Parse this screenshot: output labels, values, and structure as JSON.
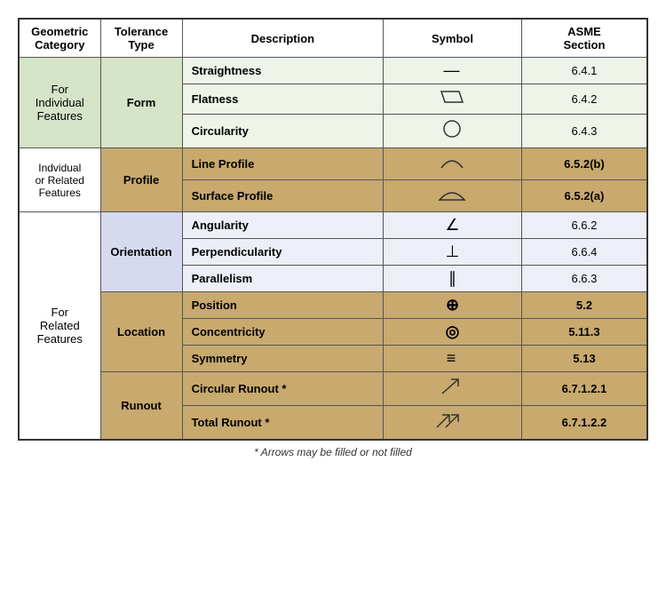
{
  "table": {
    "headers": [
      "Geometric Category",
      "Tolerance Type",
      "Description",
      "Symbol",
      "ASME Section"
    ],
    "footnote": "* Arrows may be filled or not filled",
    "rows": {
      "form": {
        "geo_cat": "For Individual Features",
        "tol_type": "Form",
        "items": [
          {
            "desc": "Straightness",
            "symbol": "—",
            "asme": "6.4.1"
          },
          {
            "desc": "Flatness",
            "symbol": "▱",
            "asme": "6.4.2"
          },
          {
            "desc": "Circularity",
            "symbol": "○",
            "asme": "6.4.3"
          }
        ]
      },
      "profile": {
        "geo_cat": "Indvidual or Related Features",
        "tol_type": "Profile",
        "items": [
          {
            "desc": "Line Profile",
            "symbol": "⌢",
            "asme": "6.5.2(b)"
          },
          {
            "desc": "Surface Profile",
            "symbol": "⌓",
            "asme": "6.5.2(a)"
          }
        ]
      },
      "related": {
        "geo_cat": "For Related Features",
        "orientation": {
          "tol_type": "Orientation",
          "items": [
            {
              "desc": "Angularity",
              "symbol": "∠",
              "asme": "6.6.2"
            },
            {
              "desc": "Perpendicularity",
              "symbol": "⊥",
              "asme": "6.6.4"
            },
            {
              "desc": "Parallelism",
              "symbol": "∥",
              "asme": "6.6.3"
            }
          ]
        },
        "location": {
          "tol_type": "Location",
          "items": [
            {
              "desc": "Position",
              "symbol": "⊕",
              "asme": "5.2"
            },
            {
              "desc": "Concentricity",
              "symbol": "◎",
              "asme": "5.11.3"
            },
            {
              "desc": "Symmetry",
              "symbol": "≡",
              "asme": "5.13"
            }
          ]
        },
        "runout": {
          "tol_type": "Runout",
          "items": [
            {
              "desc": "Circular Runout *",
              "symbol": "↗",
              "asme": "6.7.1.2.1"
            },
            {
              "desc": "Total Runout *",
              "symbol": "↗↗",
              "asme": "6.7.1.2.2"
            }
          ]
        }
      }
    }
  }
}
